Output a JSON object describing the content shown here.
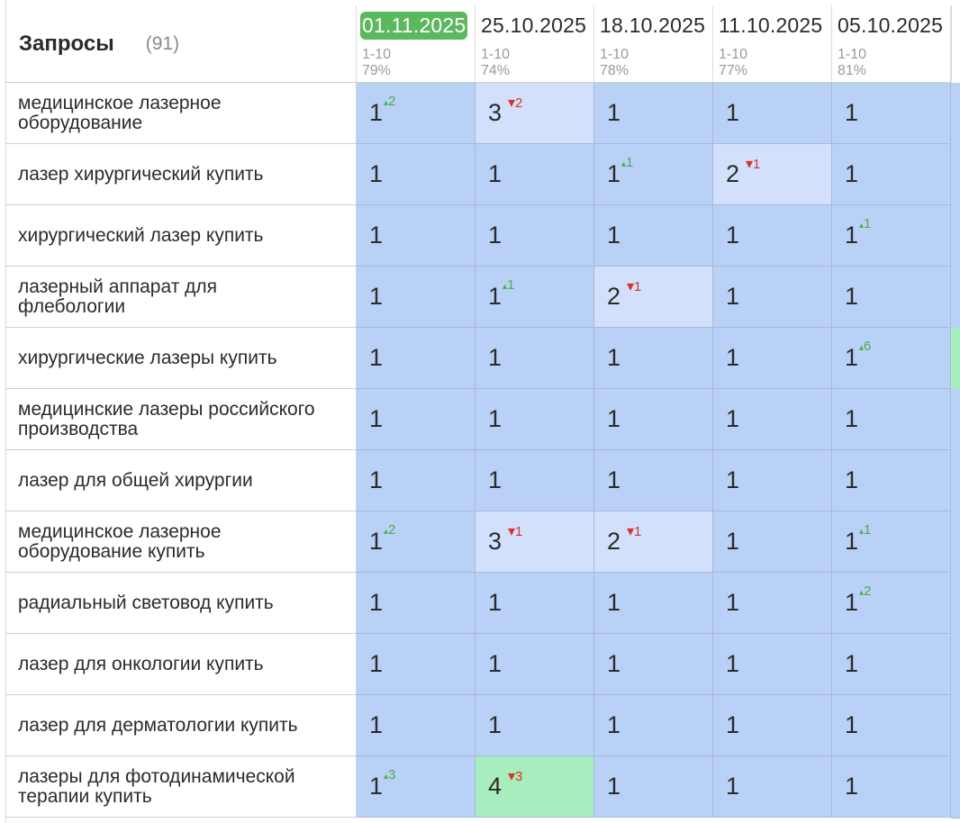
{
  "header": {
    "title": "Запросы",
    "count": "(91)",
    "dates": [
      {
        "label": "01.11.2025",
        "range": "1-10",
        "pct": "79%",
        "active": true
      },
      {
        "label": "25.10.2025",
        "range": "1-10",
        "pct": "74%",
        "active": false
      },
      {
        "label": "18.10.2025",
        "range": "1-10",
        "pct": "78%",
        "active": false
      },
      {
        "label": "11.10.2025",
        "range": "1-10",
        "pct": "77%",
        "active": false
      },
      {
        "label": "05.10.2025",
        "range": "1-10",
        "pct": "81%",
        "active": false
      }
    ]
  },
  "rows": [
    {
      "query": "медицинское лазерное оборудование",
      "cells": [
        {
          "value": "1",
          "delta": "2",
          "dir": "up"
        },
        {
          "value": "3",
          "delta": "2",
          "dir": "down",
          "tone": "light"
        },
        {
          "value": "1"
        },
        {
          "value": "1"
        },
        {
          "value": "1"
        }
      ]
    },
    {
      "query": "лазер хирургический купить",
      "cells": [
        {
          "value": "1"
        },
        {
          "value": "1"
        },
        {
          "value": "1",
          "delta": "1",
          "dir": "up"
        },
        {
          "value": "2",
          "delta": "1",
          "dir": "down",
          "tone": "light"
        },
        {
          "value": "1"
        }
      ]
    },
    {
      "query": "хирургический лазер купить",
      "cells": [
        {
          "value": "1"
        },
        {
          "value": "1"
        },
        {
          "value": "1"
        },
        {
          "value": "1"
        },
        {
          "value": "1",
          "delta": "1",
          "dir": "up"
        }
      ]
    },
    {
      "query": "лазерный аппарат для флебологии",
      "cells": [
        {
          "value": "1"
        },
        {
          "value": "1",
          "delta": "1",
          "dir": "up"
        },
        {
          "value": "2",
          "delta": "1",
          "dir": "down",
          "tone": "light"
        },
        {
          "value": "1"
        },
        {
          "value": "1"
        }
      ]
    },
    {
      "query": "хирургические лазеры купить",
      "cells": [
        {
          "value": "1"
        },
        {
          "value": "1"
        },
        {
          "value": "1"
        },
        {
          "value": "1"
        },
        {
          "value": "1",
          "delta": "6",
          "dir": "up"
        }
      ],
      "edge": "green"
    },
    {
      "query": "медицинские лазеры российского производства",
      "cells": [
        {
          "value": "1"
        },
        {
          "value": "1"
        },
        {
          "value": "1"
        },
        {
          "value": "1"
        },
        {
          "value": "1"
        }
      ]
    },
    {
      "query": "лазер для общей хирургии",
      "cells": [
        {
          "value": "1"
        },
        {
          "value": "1"
        },
        {
          "value": "1"
        },
        {
          "value": "1"
        },
        {
          "value": "1"
        }
      ]
    },
    {
      "query": "медицинское лазерное оборудование купить",
      "cells": [
        {
          "value": "1",
          "delta": "2",
          "dir": "up"
        },
        {
          "value": "3",
          "delta": "1",
          "dir": "down",
          "tone": "light"
        },
        {
          "value": "2",
          "delta": "1",
          "dir": "down",
          "tone": "light"
        },
        {
          "value": "1"
        },
        {
          "value": "1",
          "delta": "1",
          "dir": "up"
        }
      ]
    },
    {
      "query": "радиальный световод купить",
      "cells": [
        {
          "value": "1"
        },
        {
          "value": "1"
        },
        {
          "value": "1"
        },
        {
          "value": "1"
        },
        {
          "value": "1",
          "delta": "2",
          "dir": "up"
        }
      ]
    },
    {
      "query": "лазер для онкологии купить",
      "cells": [
        {
          "value": "1"
        },
        {
          "value": "1"
        },
        {
          "value": "1"
        },
        {
          "value": "1"
        },
        {
          "value": "1"
        }
      ]
    },
    {
      "query": "лазер для дерматологии купить",
      "cells": [
        {
          "value": "1"
        },
        {
          "value": "1"
        },
        {
          "value": "1"
        },
        {
          "value": "1"
        },
        {
          "value": "1"
        }
      ]
    },
    {
      "query": "лазеры для фотодинамической терапии купить",
      "cells": [
        {
          "value": "1",
          "delta": "3",
          "dir": "up"
        },
        {
          "value": "4",
          "delta": "3",
          "dir": "down",
          "tone": "green"
        },
        {
          "value": "1"
        },
        {
          "value": "1"
        },
        {
          "value": "1"
        }
      ]
    }
  ],
  "colors": {
    "active_date": "#5cb85c",
    "cell_default": "#b9d0f7",
    "cell_light": "#d3e0fb",
    "cell_green": "#a8edbd",
    "delta_up": "#4cae4c",
    "delta_down": "#d9342b"
  }
}
